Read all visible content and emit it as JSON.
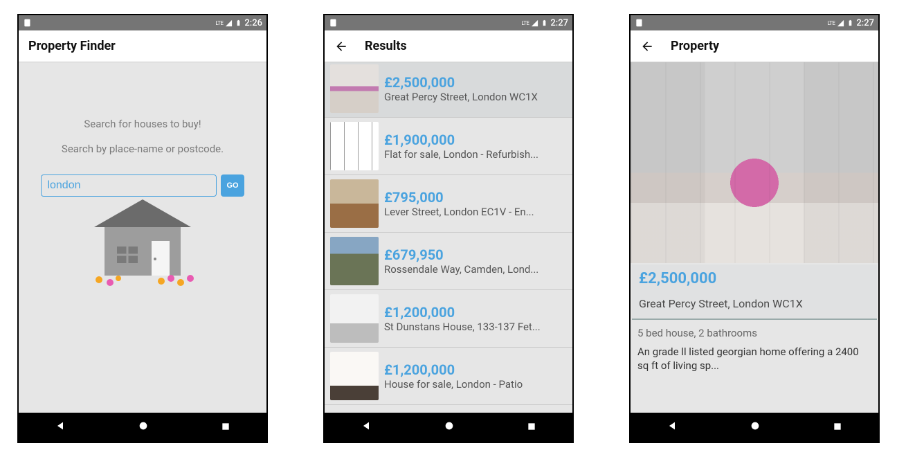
{
  "status": {
    "signal_label": "LTE",
    "time1": "2:26",
    "time2": "2:27",
    "time3": "2:27"
  },
  "screen1": {
    "title": "Property Finder",
    "hint1": "Search for houses to buy!",
    "hint2": "Search by place-name or postcode.",
    "input_value": "london",
    "go_label": "GO"
  },
  "screen2": {
    "title": "Results",
    "items": [
      {
        "price": "£2,500,000",
        "addr": "Great Percy Street, London WC1X",
        "thumb": "kitchen"
      },
      {
        "price": "£1,900,000",
        "addr": "Flat for sale, London - Refurbish...",
        "thumb": "floorplan"
      },
      {
        "price": "£795,000",
        "addr": "Lever Street, London EC1V - En...",
        "thumb": "lever"
      },
      {
        "price": "£679,950",
        "addr": "Rossendale Way, Camden, Lond...",
        "thumb": "camden"
      },
      {
        "price": "£1,200,000",
        "addr": "St Dunstans House, 133-137 Fet...",
        "thumb": "dunstans"
      },
      {
        "price": "£1,200,000",
        "addr": "House for sale, London - Patio",
        "thumb": "patio"
      }
    ]
  },
  "screen3": {
    "title": "Property",
    "price": "£2,500,000",
    "addr": "Great Percy Street, London WC1X",
    "meta": "5 bed house, 2 bathrooms",
    "desc": "An grade ll listed georgian home offering a 2400 sq ft of living sp..."
  }
}
